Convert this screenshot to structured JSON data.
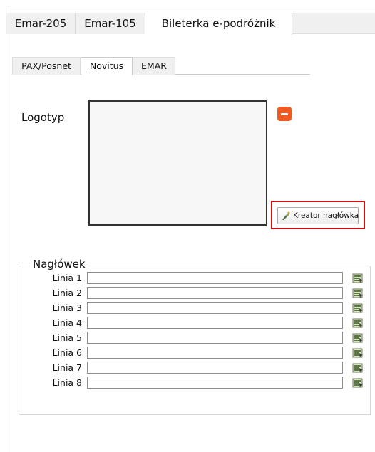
{
  "top_tabs": [
    "Emar-205",
    "Emar-105",
    "Bileterka e-podróżnik"
  ],
  "sub_tabs": [
    "PAX/Posnet",
    "Novitus",
    "EMAR"
  ],
  "logo": {
    "label": "Logotyp"
  },
  "kreator_button": {
    "label": "Kreator nagłówka",
    "icon": "wizard-icon"
  },
  "header_group": {
    "title": "Nagłówek",
    "rows": [
      {
        "label": "Linia 1",
        "value": ""
      },
      {
        "label": "Linia 2",
        "value": ""
      },
      {
        "label": "Linia 3",
        "value": ""
      },
      {
        "label": "Linia 4",
        "value": ""
      },
      {
        "label": "Linia 5",
        "value": ""
      },
      {
        "label": "Linia 6",
        "value": ""
      },
      {
        "label": "Linia 7",
        "value": ""
      },
      {
        "label": "Linia 8",
        "value": ""
      }
    ]
  },
  "colors": {
    "remove_button": "#f05a22",
    "highlight": "#cc1111"
  }
}
